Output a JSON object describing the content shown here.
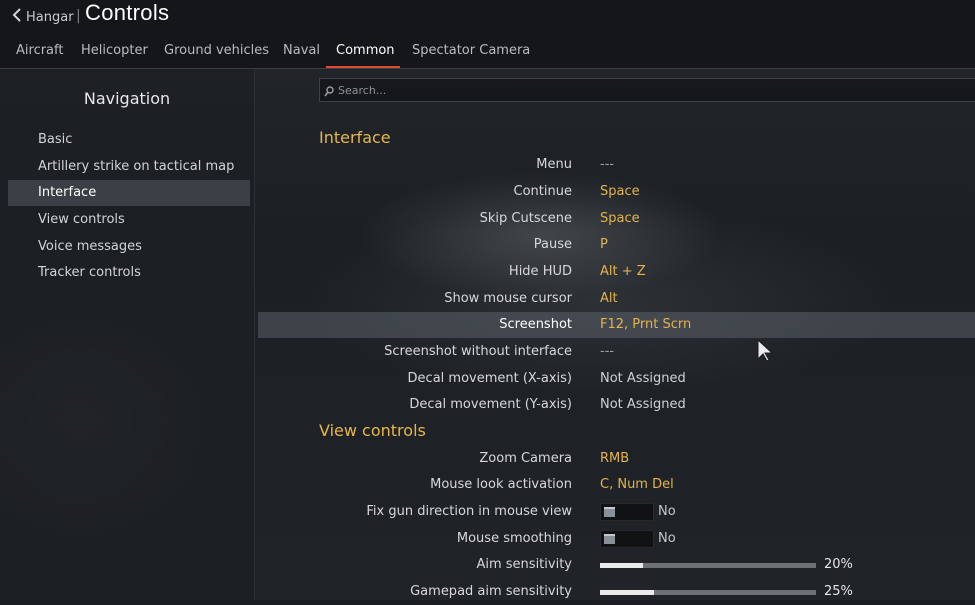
{
  "header": {
    "back_label": "Hangar",
    "separator": "|",
    "title": "Controls"
  },
  "tabs": [
    {
      "label": "Aircraft"
    },
    {
      "label": "Helicopter"
    },
    {
      "label": "Ground vehicles"
    },
    {
      "label": "Naval"
    },
    {
      "label": "Common",
      "active": true
    },
    {
      "label": "Spectator Camera"
    }
  ],
  "sidebar": {
    "title": "Navigation",
    "items": [
      {
        "label": "Basic"
      },
      {
        "label": "Artillery strike on tactical map"
      },
      {
        "label": "Interface",
        "active": true
      },
      {
        "label": "View controls"
      },
      {
        "label": "Voice messages"
      },
      {
        "label": "Tracker controls"
      }
    ]
  },
  "search": {
    "placeholder": "Search..."
  },
  "sections": [
    {
      "title": "Interface",
      "rows": [
        {
          "label": "Menu",
          "value": "---"
        },
        {
          "label": "Continue",
          "value": "Space"
        },
        {
          "label": "Skip Cutscene",
          "value": "Space"
        },
        {
          "label": "Pause",
          "value": "P"
        },
        {
          "label": "Hide HUD",
          "value": "Alt + Z"
        },
        {
          "label": "Show mouse cursor",
          "value": "Alt"
        },
        {
          "label": "Screenshot",
          "value": "F12, Prnt Scrn",
          "highlighted": true
        },
        {
          "label": "Screenshot without interface",
          "value": "---"
        },
        {
          "label": "Decal movement (X-axis)",
          "value": "Not Assigned"
        },
        {
          "label": "Decal movement (Y-axis)",
          "value": "Not Assigned"
        }
      ]
    },
    {
      "title": "View controls",
      "rows": [
        {
          "label": "Zoom Camera",
          "value": "RMB"
        },
        {
          "label": "Mouse look activation",
          "value": "C, Num Del"
        },
        {
          "label": "Fix gun direction in mouse view",
          "toggle_value": "No"
        },
        {
          "label": "Mouse smoothing",
          "toggle_value": "No"
        },
        {
          "label": "Aim sensitivity",
          "slider_value": "20%",
          "slider_fraction": 0.2
        },
        {
          "label": "Gamepad aim sensitivity",
          "slider_value": "25%",
          "slider_fraction": 0.25
        }
      ]
    }
  ],
  "colors": {
    "accent_tab": "#e04a2e",
    "binding_gold": "#e5b34d",
    "section_gold": "#e8b64a"
  }
}
